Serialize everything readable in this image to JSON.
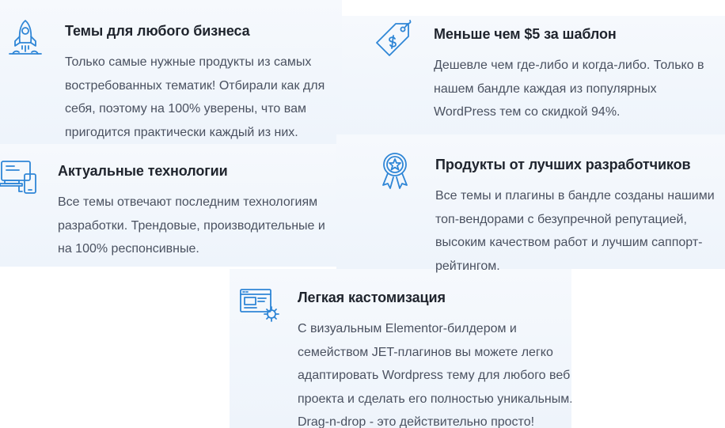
{
  "features": [
    {
      "title": "Темы для любого бизнеса",
      "text": "Только самые нужные продукты из самых востребованных тематик! Отбирали как для себя, поэтому на 100% уверены, что вам пригодится практически каждый из них.",
      "icon": "rocket-icon"
    },
    {
      "title": "Меньше чем $5 за шаблон",
      "text": "Дешевле чем где-либо и когда-либо. Только в нашем бандле каждая из популярных WordPress тем со скидкой 94%.",
      "icon": "price-tag-icon"
    },
    {
      "title": "Актуальные технологии",
      "text": "Все темы отвечают последним технологиям разработки. Трендовые, производительные и на 100% респонсивные.",
      "icon": "devices-icon"
    },
    {
      "title": "Продукты от лучших разработчиков",
      "text": "Все темы и плагины в бандле созданы нашими топ-вендорами с безупречной репутацией, высоким качеством работ и лучшим саппорт-рейтингом.",
      "icon": "award-ribbon-icon"
    },
    {
      "title": "Легкая кастомизация",
      "text": "С визуальным Elementor-билдером и семейством JET-плагинов вы можете легко адаптировать Wordpress тему для любого веб проекта и сделать его полностью уникальным. Drag-n-drop - это действительно просто!",
      "icon": "customize-window-icon"
    }
  ],
  "colors": {
    "icon": "#2f86d6",
    "title": "#1f242d",
    "text": "#4a5160",
    "panel": "#f3f7fc"
  }
}
